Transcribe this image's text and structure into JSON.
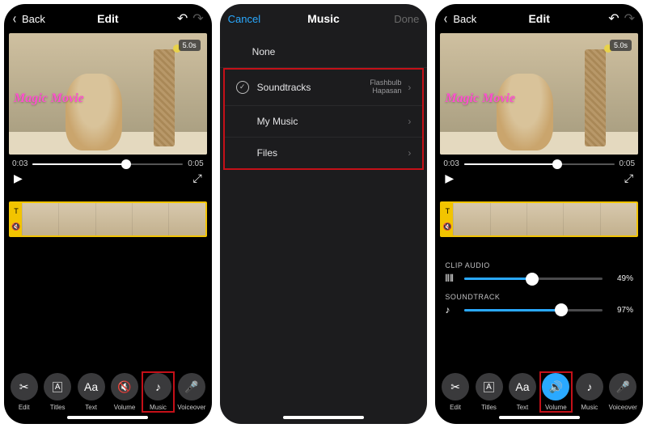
{
  "left": {
    "nav": {
      "back": "Back",
      "title": "Edit"
    },
    "preview": {
      "badge": "5.0s",
      "overlay": "Magic Movie"
    },
    "time": {
      "current": "0:03",
      "total": "0:05"
    },
    "tools": [
      {
        "label": "Edit"
      },
      {
        "label": "Titles"
      },
      {
        "label": "Text",
        "glyph": "Aa"
      },
      {
        "label": "Volume"
      },
      {
        "label": "Music"
      },
      {
        "label": "Voiceover"
      }
    ]
  },
  "middle": {
    "nav": {
      "cancel": "Cancel",
      "title": "Music",
      "done": "Done"
    },
    "rows": {
      "none": "None",
      "soundtracks": {
        "label": "Soundtracks",
        "sub1": "Flashbulb",
        "sub2": "Hapasan"
      },
      "mymusic": "My Music",
      "files": "Files"
    }
  },
  "right": {
    "nav": {
      "back": "Back",
      "title": "Edit"
    },
    "preview": {
      "badge": "5.0s",
      "overlay": "Magic Movie"
    },
    "time": {
      "current": "0:03",
      "total": "0:05"
    },
    "volume": {
      "clip": {
        "label": "CLIP AUDIO",
        "pct": "49%",
        "fill": 49
      },
      "track": {
        "label": "SOUNDTRACK",
        "pct": "97%",
        "fill": 70
      }
    },
    "tools": [
      {
        "label": "Edit"
      },
      {
        "label": "Titles"
      },
      {
        "label": "Text",
        "glyph": "Aa"
      },
      {
        "label": "Volume"
      },
      {
        "label": "Music"
      },
      {
        "label": "Voiceover"
      }
    ]
  }
}
